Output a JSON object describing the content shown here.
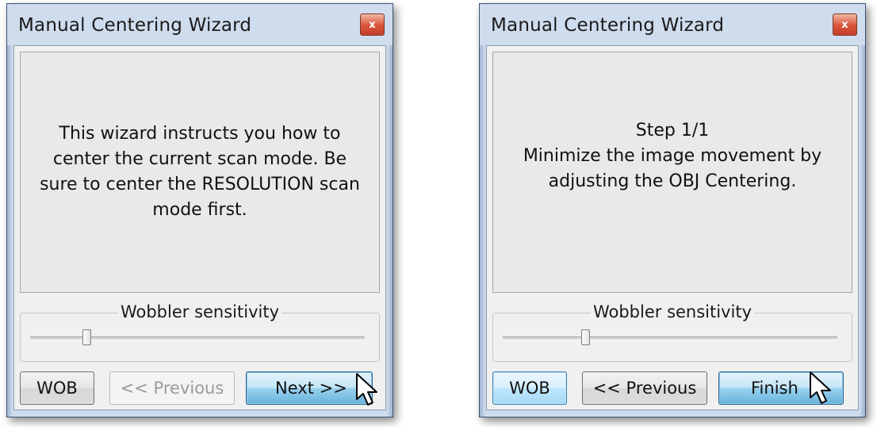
{
  "dialogs": [
    {
      "title": "Manual Centering Wizard",
      "close_label": "x",
      "message": "This wizard instructs you how to\ncenter the current scan mode. Be\nsure to center the RESOLUTION scan\nmode first.",
      "slider": {
        "label": "Wobbler sensitivity",
        "value_fraction": 0.16
      },
      "buttons": {
        "wob": "WOB",
        "previous": "<< Previous",
        "next": "Next >>"
      },
      "previous_enabled": false
    },
    {
      "title": "Manual Centering Wizard",
      "close_label": "x",
      "message": "Step 1/1\nMinimize the image movement by\nadjusting the OBJ Centering.",
      "slider": {
        "label": "Wobbler sensitivity",
        "value_fraction": 0.24
      },
      "buttons": {
        "wob": "WOB",
        "previous": "<< Previous",
        "finish": "Finish"
      },
      "previous_enabled": true
    }
  ]
}
